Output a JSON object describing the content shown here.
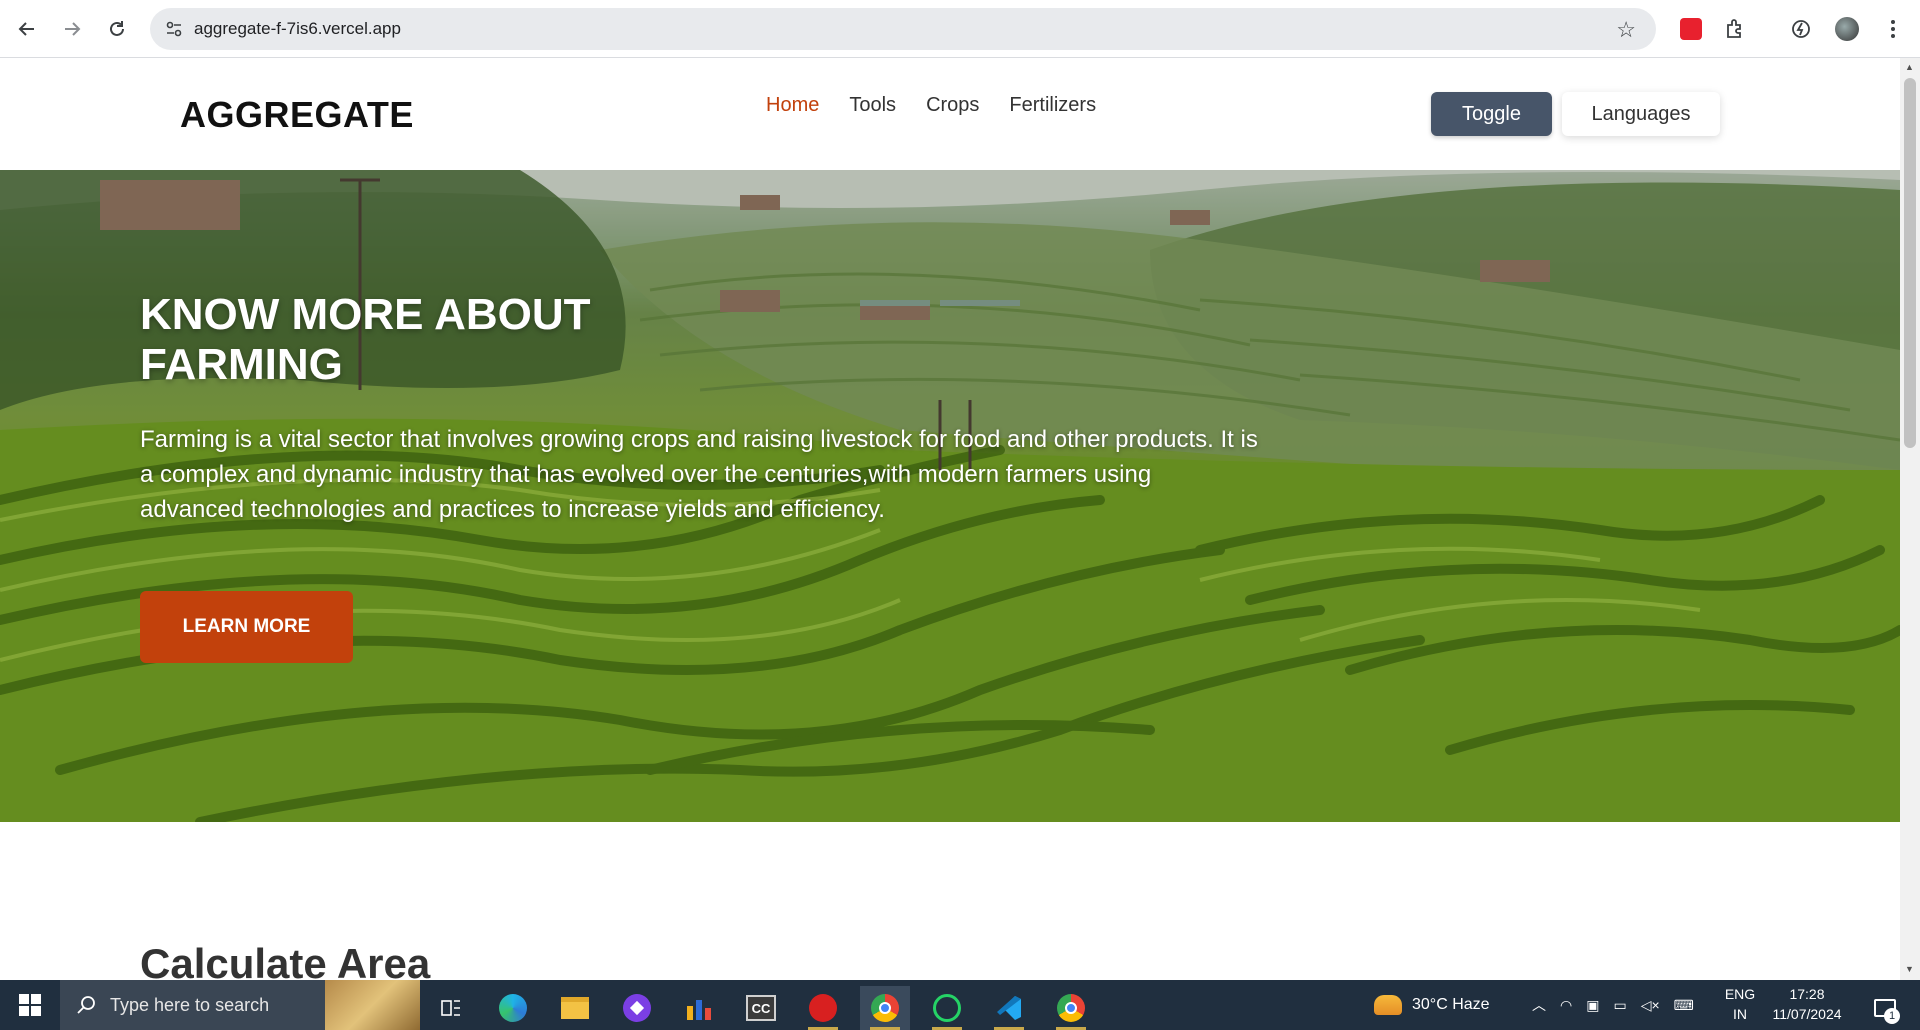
{
  "browser": {
    "url": "aggregate-f-7is6.vercel.app"
  },
  "site": {
    "logo": "AGGREGATE",
    "nav": [
      {
        "label": "Home",
        "active": true
      },
      {
        "label": "Tools",
        "active": false
      },
      {
        "label": "Crops",
        "active": false
      },
      {
        "label": "Fertilizers",
        "active": false
      }
    ],
    "toggle_label": "Toggle",
    "languages_label": "Languages"
  },
  "hero": {
    "title_line1": "KNOW MORE ABOUT",
    "title_line2": "FARMING",
    "text": "Farming is a vital sector that involves growing crops and raising livestock for food and other products. It is a complex and dynamic industry that has evolved over the centuries,with modern farmers using advanced technologies and practices to increase yields and efficiency.",
    "button_label": "LEARN MORE"
  },
  "section": {
    "title": "Calculate Area"
  },
  "taskbar": {
    "search_placeholder": "Type here to search",
    "weather": "30°C  Haze",
    "lang_top": "ENG",
    "lang_bottom": "IN",
    "time": "17:28",
    "date": "11/07/2024",
    "notification_count": "1"
  },
  "colors": {
    "accent": "#c2410c",
    "toggle_bg": "#475569",
    "taskbar_bg": "#202f3f"
  }
}
